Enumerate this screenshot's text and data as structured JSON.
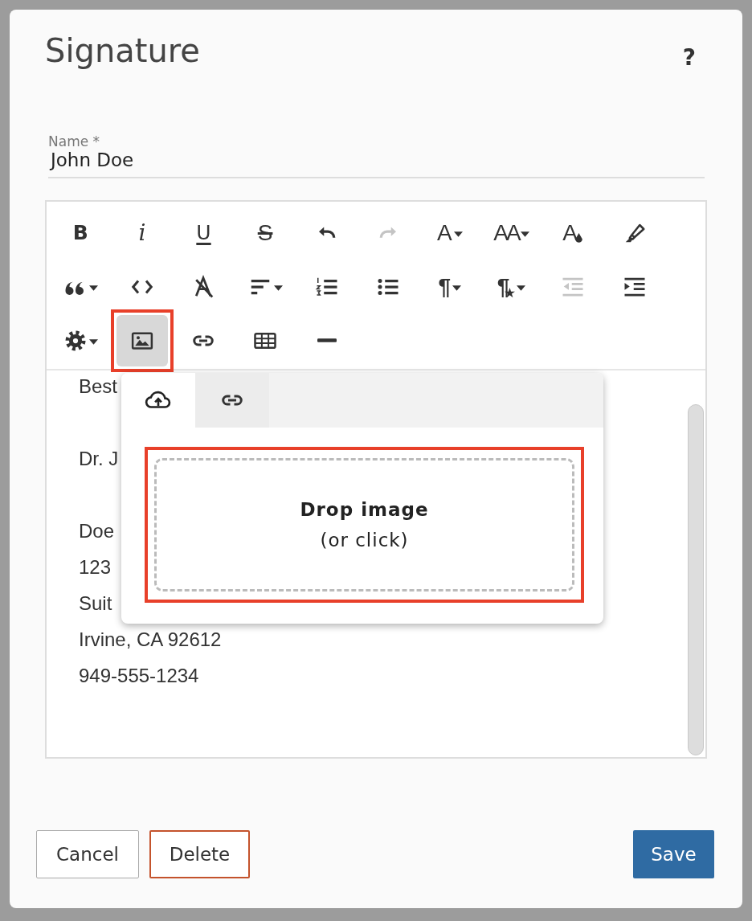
{
  "dialog": {
    "title": "Signature",
    "help": "?"
  },
  "name_field": {
    "label": "Name *",
    "value": "John Doe"
  },
  "toolbar": {
    "rows": [
      [
        {
          "kind": "bold",
          "label": "B",
          "caret": false,
          "disabled": false,
          "active": false,
          "highlighted": false
        },
        {
          "kind": "italic",
          "label": "i",
          "caret": false,
          "disabled": false,
          "active": false,
          "highlighted": false
        },
        {
          "kind": "underline",
          "label": "U",
          "caret": false,
          "disabled": false,
          "active": false,
          "highlighted": false
        },
        {
          "kind": "strikethrough",
          "label": "S",
          "caret": false,
          "disabled": false,
          "active": false,
          "highlighted": false
        },
        {
          "kind": "undo",
          "caret": false,
          "disabled": false,
          "active": false,
          "highlighted": false
        },
        {
          "kind": "redo",
          "caret": false,
          "disabled": true,
          "active": false,
          "highlighted": false
        },
        {
          "kind": "font",
          "label": "A",
          "caret": true,
          "disabled": false,
          "active": false,
          "highlighted": false
        },
        {
          "kind": "font-size",
          "label": "AA",
          "caret": true,
          "disabled": false,
          "active": false,
          "highlighted": false
        },
        {
          "kind": "font-color",
          "label": "A",
          "caret": false,
          "disabled": false,
          "active": false,
          "highlighted": false
        },
        {
          "kind": "highlight",
          "caret": false,
          "disabled": false,
          "active": false,
          "highlighted": false
        }
      ],
      [
        {
          "kind": "quote",
          "caret": true,
          "disabled": false,
          "active": false,
          "highlighted": false
        },
        {
          "kind": "code",
          "caret": false,
          "disabled": false,
          "active": false,
          "highlighted": false
        },
        {
          "kind": "clear-format",
          "caret": false,
          "disabled": false,
          "active": false,
          "highlighted": false
        },
        {
          "kind": "align",
          "caret": true,
          "disabled": false,
          "active": false,
          "highlighted": false
        },
        {
          "kind": "ordered-list",
          "caret": false,
          "disabled": false,
          "active": false,
          "highlighted": false
        },
        {
          "kind": "bullet-list",
          "caret": false,
          "disabled": false,
          "active": false,
          "highlighted": false
        },
        {
          "kind": "paragraph",
          "label": "¶",
          "caret": true,
          "disabled": false,
          "active": false,
          "highlighted": false
        },
        {
          "kind": "paragraph-style",
          "label": "¶",
          "caret": true,
          "disabled": false,
          "active": false,
          "highlighted": false
        },
        {
          "kind": "outdent",
          "caret": false,
          "disabled": true,
          "active": false,
          "highlighted": false
        },
        {
          "kind": "indent",
          "caret": false,
          "disabled": false,
          "active": false,
          "highlighted": false
        }
      ],
      [
        {
          "kind": "settings",
          "caret": true,
          "disabled": false,
          "active": false,
          "highlighted": false
        },
        {
          "kind": "image",
          "caret": false,
          "disabled": false,
          "active": true,
          "highlighted": true
        },
        {
          "kind": "link",
          "caret": false,
          "disabled": false,
          "active": false,
          "highlighted": false
        },
        {
          "kind": "table",
          "caret": false,
          "disabled": false,
          "active": false,
          "highlighted": false
        },
        {
          "kind": "horizontal-rule",
          "caret": false,
          "disabled": false,
          "active": false,
          "highlighted": false
        }
      ]
    ]
  },
  "editor": {
    "paragraphs": [
      [
        "Best"
      ],
      [
        "Dr. J"
      ],
      [
        "Doe",
        "123",
        "Suit",
        "Irvine, CA 92612",
        "949-555-1234"
      ]
    ]
  },
  "image_popover": {
    "tabs": [
      {
        "kind": "upload",
        "selected": true
      },
      {
        "kind": "link",
        "selected": false
      }
    ],
    "drop_zone": {
      "title": "Drop image",
      "hint": "(or click)",
      "highlighted": true
    }
  },
  "buttons": [
    {
      "kind": "cancel",
      "label": "Cancel"
    },
    {
      "kind": "delete",
      "label": "Delete"
    },
    {
      "kind": "save",
      "label": "Save"
    }
  ]
}
